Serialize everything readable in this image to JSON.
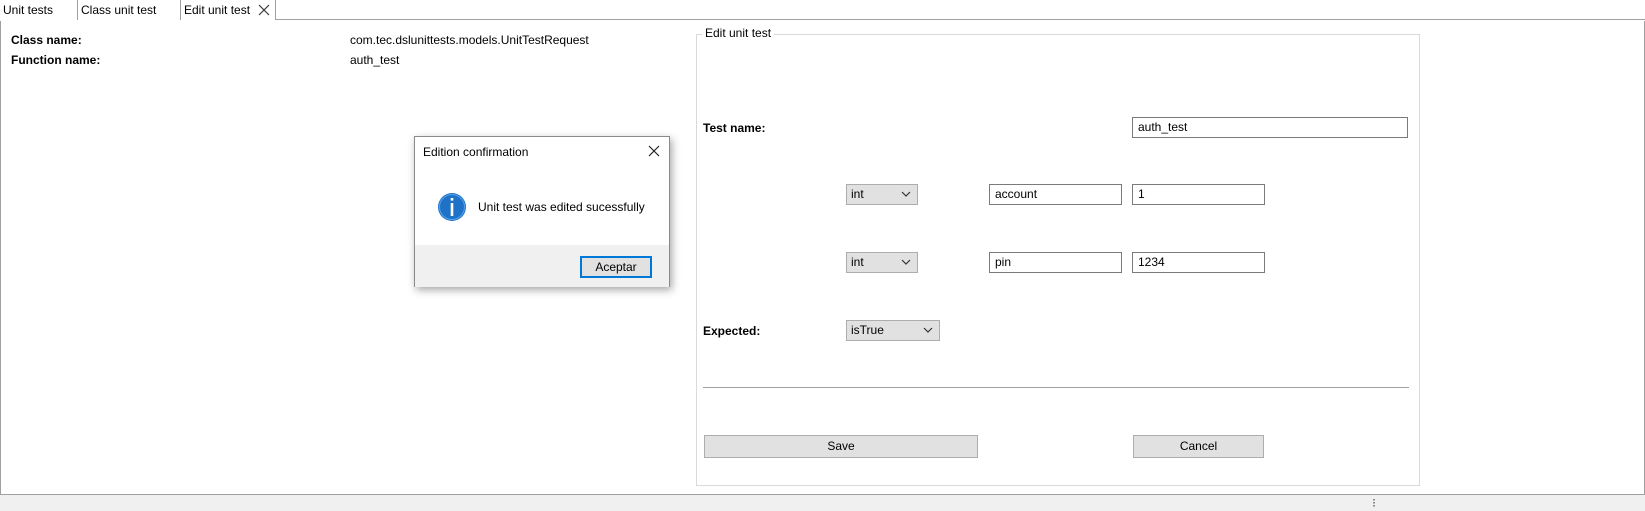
{
  "tabs": [
    {
      "label": "Unit tests"
    },
    {
      "label": "Class unit test"
    },
    {
      "label": "Edit unit test"
    }
  ],
  "info": {
    "class_name_label": "Class name:",
    "class_name_value": "com.tec.dslunittests.models.UnitTestRequest",
    "function_name_label": "Function name:",
    "function_name_value": "auth_test"
  },
  "edit_panel": {
    "title": "Edit unit test",
    "test_name_label": "Test name:",
    "test_name_value": "auth_test",
    "params": [
      {
        "type": "int",
        "name": "account",
        "value": "1"
      },
      {
        "type": "int",
        "name": "pin",
        "value": "1234"
      }
    ],
    "expected_label": "Expected:",
    "expected_value": "isTrue",
    "save_label": "Save",
    "cancel_label": "Cancel"
  },
  "dialog": {
    "title": "Edition confirmation",
    "message": "Unit test was edited sucessfully",
    "ok_label": "Aceptar"
  },
  "colors": {
    "accent": "#0078d7",
    "info_icon": "#1e73c8"
  },
  "icons": {
    "tab_close": "close-icon",
    "dialog_close": "close-icon",
    "info": "info-icon",
    "dropdown": "chevron-down-icon"
  }
}
